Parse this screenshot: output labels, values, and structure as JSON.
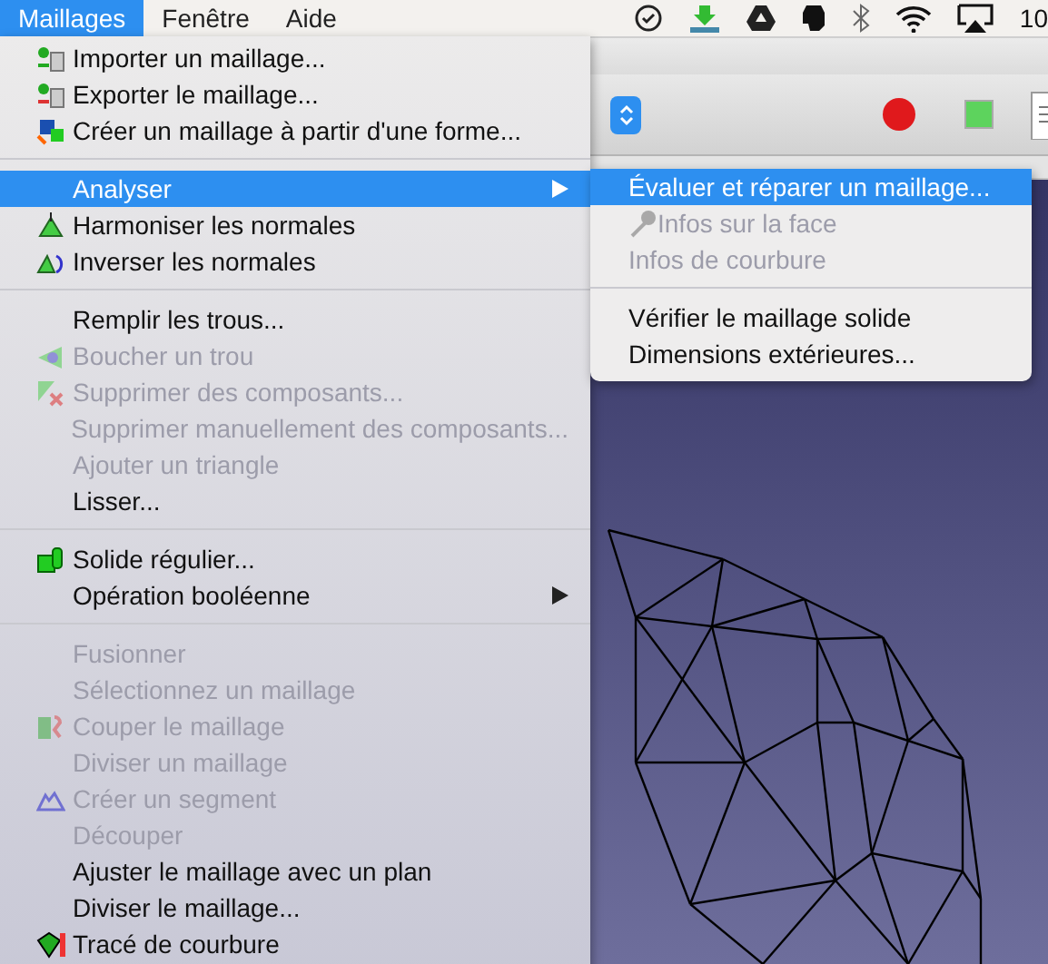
{
  "menu_bar": {
    "menus": [
      {
        "label": "Maillages",
        "selected": true
      },
      {
        "label": "Fenêtre",
        "selected": false
      },
      {
        "label": "Aide",
        "selected": false
      }
    ],
    "clock": "10"
  },
  "menu": {
    "items": [
      {
        "kind": "item",
        "label": "Importer un maillage...",
        "has_icon": true,
        "disabled": false,
        "selected": false
      },
      {
        "kind": "item",
        "label": "Exporter le maillage...",
        "has_icon": true,
        "disabled": false,
        "selected": false
      },
      {
        "kind": "item",
        "label": "Créer un maillage à partir d'une forme...",
        "has_icon": true,
        "disabled": false,
        "selected": false
      },
      {
        "kind": "separator"
      },
      {
        "kind": "submenu",
        "label": "Analyser",
        "has_icon": false,
        "disabled": false,
        "selected": true
      },
      {
        "kind": "item",
        "label": "Harmoniser les normales",
        "has_icon": true,
        "disabled": false,
        "selected": false
      },
      {
        "kind": "item",
        "label": "Inverser les normales",
        "has_icon": true,
        "disabled": false,
        "selected": false
      },
      {
        "kind": "separator"
      },
      {
        "kind": "item",
        "label": "Remplir les trous...",
        "has_icon": false,
        "disabled": false,
        "selected": false
      },
      {
        "kind": "item",
        "label": "Boucher un trou",
        "has_icon": true,
        "disabled": true,
        "selected": false
      },
      {
        "kind": "item",
        "label": "Supprimer des composants...",
        "has_icon": true,
        "disabled": true,
        "selected": false
      },
      {
        "kind": "item",
        "label": "Supprimer manuellement des composants...",
        "has_icon": false,
        "disabled": true,
        "selected": false
      },
      {
        "kind": "item",
        "label": "Ajouter un triangle",
        "has_icon": false,
        "disabled": true,
        "selected": false
      },
      {
        "kind": "item",
        "label": "Lisser...",
        "has_icon": false,
        "disabled": false,
        "selected": false
      },
      {
        "kind": "separator"
      },
      {
        "kind": "item",
        "label": "Solide régulier...",
        "has_icon": true,
        "disabled": false,
        "selected": false
      },
      {
        "kind": "submenu",
        "label": "Opération booléenne",
        "has_icon": false,
        "disabled": false,
        "selected": false
      },
      {
        "kind": "separator"
      },
      {
        "kind": "item",
        "label": "Fusionner",
        "has_icon": false,
        "disabled": true,
        "selected": false
      },
      {
        "kind": "item",
        "label": "Sélectionnez un maillage",
        "has_icon": false,
        "disabled": true,
        "selected": false
      },
      {
        "kind": "item",
        "label": "Couper le maillage",
        "has_icon": true,
        "disabled": true,
        "selected": false
      },
      {
        "kind": "item",
        "label": "Diviser un maillage",
        "has_icon": false,
        "disabled": true,
        "selected": false
      },
      {
        "kind": "item",
        "label": "Créer un segment",
        "has_icon": true,
        "disabled": true,
        "selected": false
      },
      {
        "kind": "item",
        "label": "Découper",
        "has_icon": false,
        "disabled": true,
        "selected": false
      },
      {
        "kind": "item",
        "label": "Ajuster le maillage avec un plan",
        "has_icon": false,
        "disabled": false,
        "selected": false
      },
      {
        "kind": "item",
        "label": "Diviser le maillage...",
        "has_icon": false,
        "disabled": false,
        "selected": false
      },
      {
        "kind": "item",
        "label": "Tracé de courbure",
        "has_icon": true,
        "disabled": false,
        "selected": false
      }
    ]
  },
  "submenu": {
    "items": [
      {
        "kind": "item",
        "label": "Évaluer et réparer un maillage...",
        "has_icon": false,
        "disabled": false,
        "selected": true
      },
      {
        "kind": "item",
        "label": "Infos sur la face",
        "has_icon": true,
        "disabled": true,
        "selected": false
      },
      {
        "kind": "item",
        "label": "Infos de courbure",
        "has_icon": false,
        "disabled": true,
        "selected": false
      },
      {
        "kind": "separator"
      },
      {
        "kind": "item",
        "label": "Vérifier le maillage solide",
        "has_icon": false,
        "disabled": false,
        "selected": false
      },
      {
        "kind": "item",
        "label": "Dimensions extérieures...",
        "has_icon": false,
        "disabled": false,
        "selected": false
      }
    ]
  }
}
